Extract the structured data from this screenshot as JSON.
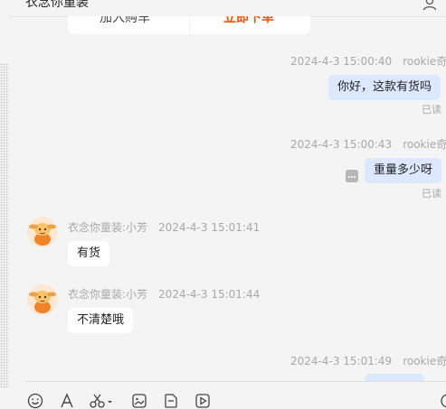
{
  "header": {
    "title": "衣念你童装"
  },
  "product_card": {
    "add_cart_label": "加入购车",
    "buy_label": "立即下单"
  },
  "messages": [
    {
      "time": "2024-4-3 15:00:40",
      "name": "rookie奇",
      "text": "你好，这款有货吗",
      "status": "已读"
    },
    {
      "time": "2024-4-3 15:00:43",
      "name": "rookie奇",
      "text": "重量多少呀",
      "status": "已读"
    },
    {
      "sender": "衣念你童装:小芳",
      "time": "2024-4-3 15:01:41",
      "text": "有货"
    },
    {
      "sender": "衣念你童装:小芳",
      "time": "2024-4-3 15:01:44",
      "text": "不清楚哦"
    },
    {
      "time": "2024-4-3 15:01:49",
      "name": "rookie奇"
    }
  ],
  "icons": {
    "user": "user-icon",
    "more": "more-icon",
    "avatar": "store-avatar",
    "toolbar": [
      "emoji-icon",
      "font-icon",
      "scissors-icon",
      "image-icon",
      "file-icon",
      "video-icon"
    ]
  },
  "colors": {
    "my_bubble": "#dce8ff",
    "buy_accent": "#ff5000"
  }
}
